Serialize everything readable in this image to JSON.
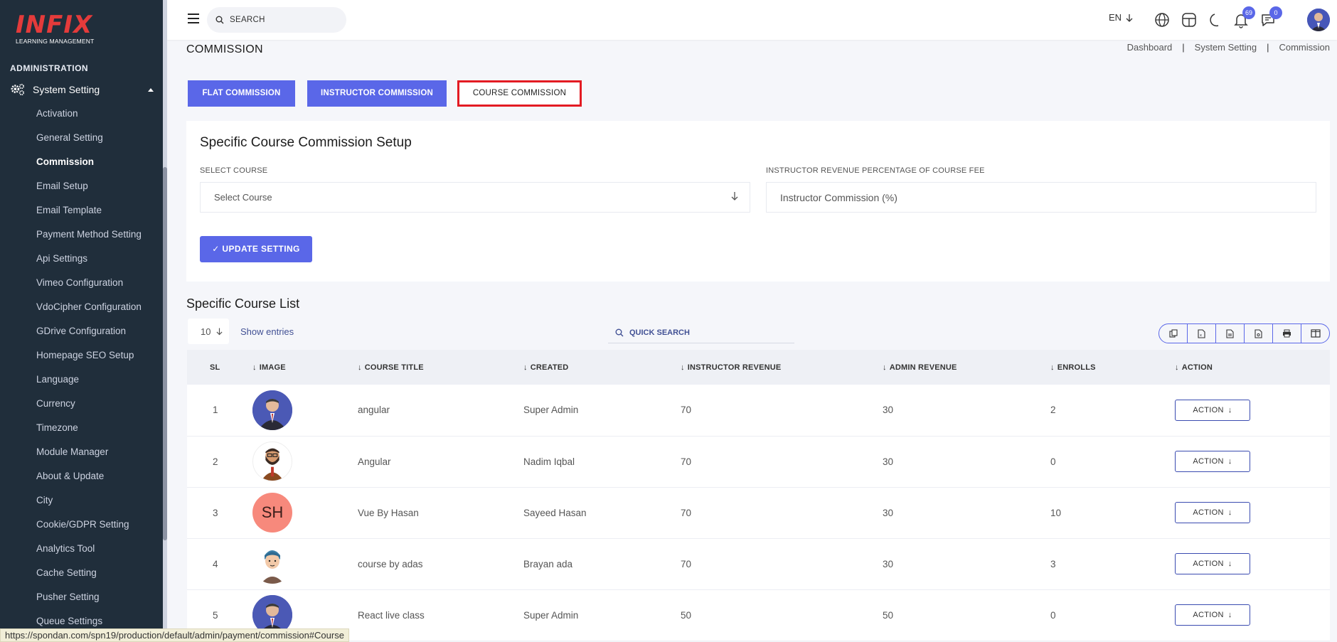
{
  "logo": {
    "brand": "INFIX",
    "tagline": "LEARNING MANAGEMENT"
  },
  "sidebar": {
    "section_title": "ADMINISTRATION",
    "group_label": "System Setting",
    "items": [
      {
        "label": "Activation"
      },
      {
        "label": "General Setting"
      },
      {
        "label": "Commission"
      },
      {
        "label": "Email Setup"
      },
      {
        "label": "Email Template"
      },
      {
        "label": "Payment Method Setting"
      },
      {
        "label": "Api Settings"
      },
      {
        "label": "Vimeo Configuration"
      },
      {
        "label": "VdoCipher Configuration"
      },
      {
        "label": "GDrive Configuration"
      },
      {
        "label": "Homepage SEO Setup"
      },
      {
        "label": "Language"
      },
      {
        "label": "Currency"
      },
      {
        "label": "Timezone"
      },
      {
        "label": "Module Manager"
      },
      {
        "label": "About & Update"
      },
      {
        "label": "City"
      },
      {
        "label": "Cookie/GDPR Setting"
      },
      {
        "label": "Analytics Tool"
      },
      {
        "label": "Cache Setting"
      },
      {
        "label": "Pusher Setting"
      },
      {
        "label": "Queue Settings"
      }
    ]
  },
  "topbar": {
    "search_placeholder": "SEARCH",
    "language": "EN",
    "notification_count": "69",
    "message_count": "0"
  },
  "page": {
    "title": "COMMISSION",
    "breadcrumb": [
      "Dashboard",
      "System Setting",
      "Commission"
    ],
    "tabs": [
      "FLAT COMMISSION",
      "INSTRUCTOR COMMISSION",
      "COURSE COMMISSION"
    ]
  },
  "setup": {
    "heading": "Specific Course Commission Setup",
    "select_label": "SELECT COURSE",
    "select_value": "Select Course",
    "revenue_label": "INSTRUCTOR REVENUE PERCENTAGE OF COURSE FEE",
    "revenue_placeholder": "Instructor Commission (%)",
    "update_label": "UPDATE SETTING"
  },
  "list": {
    "heading": "Specific Course List",
    "entries_value": "10",
    "entries_label": "Show entries",
    "quick_search_placeholder": "QUICK SEARCH",
    "columns": [
      "SL",
      "IMAGE",
      "COURSE TITLE",
      "CREATED",
      "INSTRUCTOR REVENUE",
      "ADMIN REVENUE",
      "ENROLLS",
      "ACTION"
    ],
    "rows": [
      {
        "sl": "1",
        "image": "photo-man-suit",
        "title": "angular",
        "created": "Super Admin",
        "instructor_revenue": "70",
        "admin_revenue": "30",
        "enrolls": "2",
        "action": "ACTION"
      },
      {
        "sl": "2",
        "image": "cartoon-man-beard",
        "title": "Angular",
        "created": "Nadim Iqbal",
        "instructor_revenue": "70",
        "admin_revenue": "30",
        "enrolls": "0",
        "action": "ACTION"
      },
      {
        "sl": "3",
        "image": "initials",
        "initials": "SH",
        "title": "Vue By Hasan",
        "created": "Sayeed Hasan",
        "instructor_revenue": "70",
        "admin_revenue": "30",
        "enrolls": "10",
        "action": "ACTION"
      },
      {
        "sl": "4",
        "image": "cartoon-man-blue-hair",
        "title": "course by adas",
        "created": "Brayan ada",
        "instructor_revenue": "70",
        "admin_revenue": "30",
        "enrolls": "3",
        "action": "ACTION"
      },
      {
        "sl": "5",
        "image": "photo-man-suit",
        "title": "React live class",
        "created": "Super Admin",
        "instructor_revenue": "50",
        "admin_revenue": "50",
        "enrolls": "0",
        "action": "ACTION"
      }
    ]
  },
  "status_url": "https://spondan.com/spn19/production/default/admin/payment/commission#Course",
  "colors": {
    "sidebar": "#202e3b",
    "primary": "#5a67e8",
    "highlight": "#e31b23",
    "initials_bg": "#f7897c"
  }
}
